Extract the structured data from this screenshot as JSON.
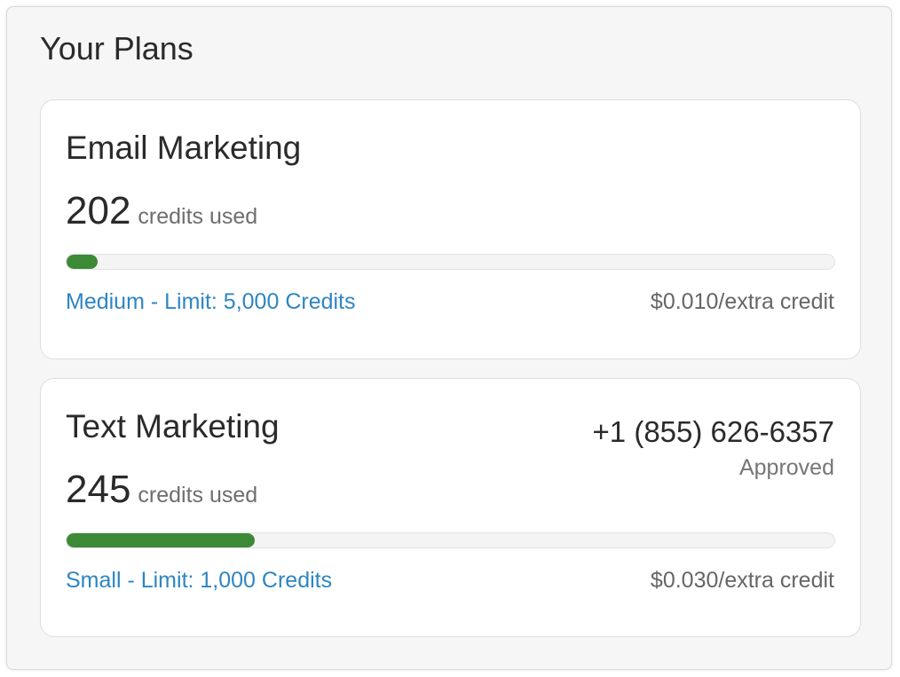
{
  "panel": {
    "title": "Your Plans"
  },
  "plans": [
    {
      "title": "Email Marketing",
      "credits_used": "202",
      "credits_suffix": "credits used",
      "usage_fraction": 0.04,
      "plan_label": "Medium - Limit: 5,000 Credits",
      "rate": "$0.010/extra credit"
    },
    {
      "title": "Text Marketing",
      "phone": "+1 (855) 626-6357",
      "status": "Approved",
      "credits_used": "245",
      "credits_suffix": "credits used",
      "usage_fraction": 0.245,
      "plan_label": "Small - Limit: 1,000 Credits",
      "rate": "$0.030/extra credit"
    }
  ],
  "colors": {
    "progress_fill": "#3c8a36",
    "link": "#2e86c1"
  }
}
